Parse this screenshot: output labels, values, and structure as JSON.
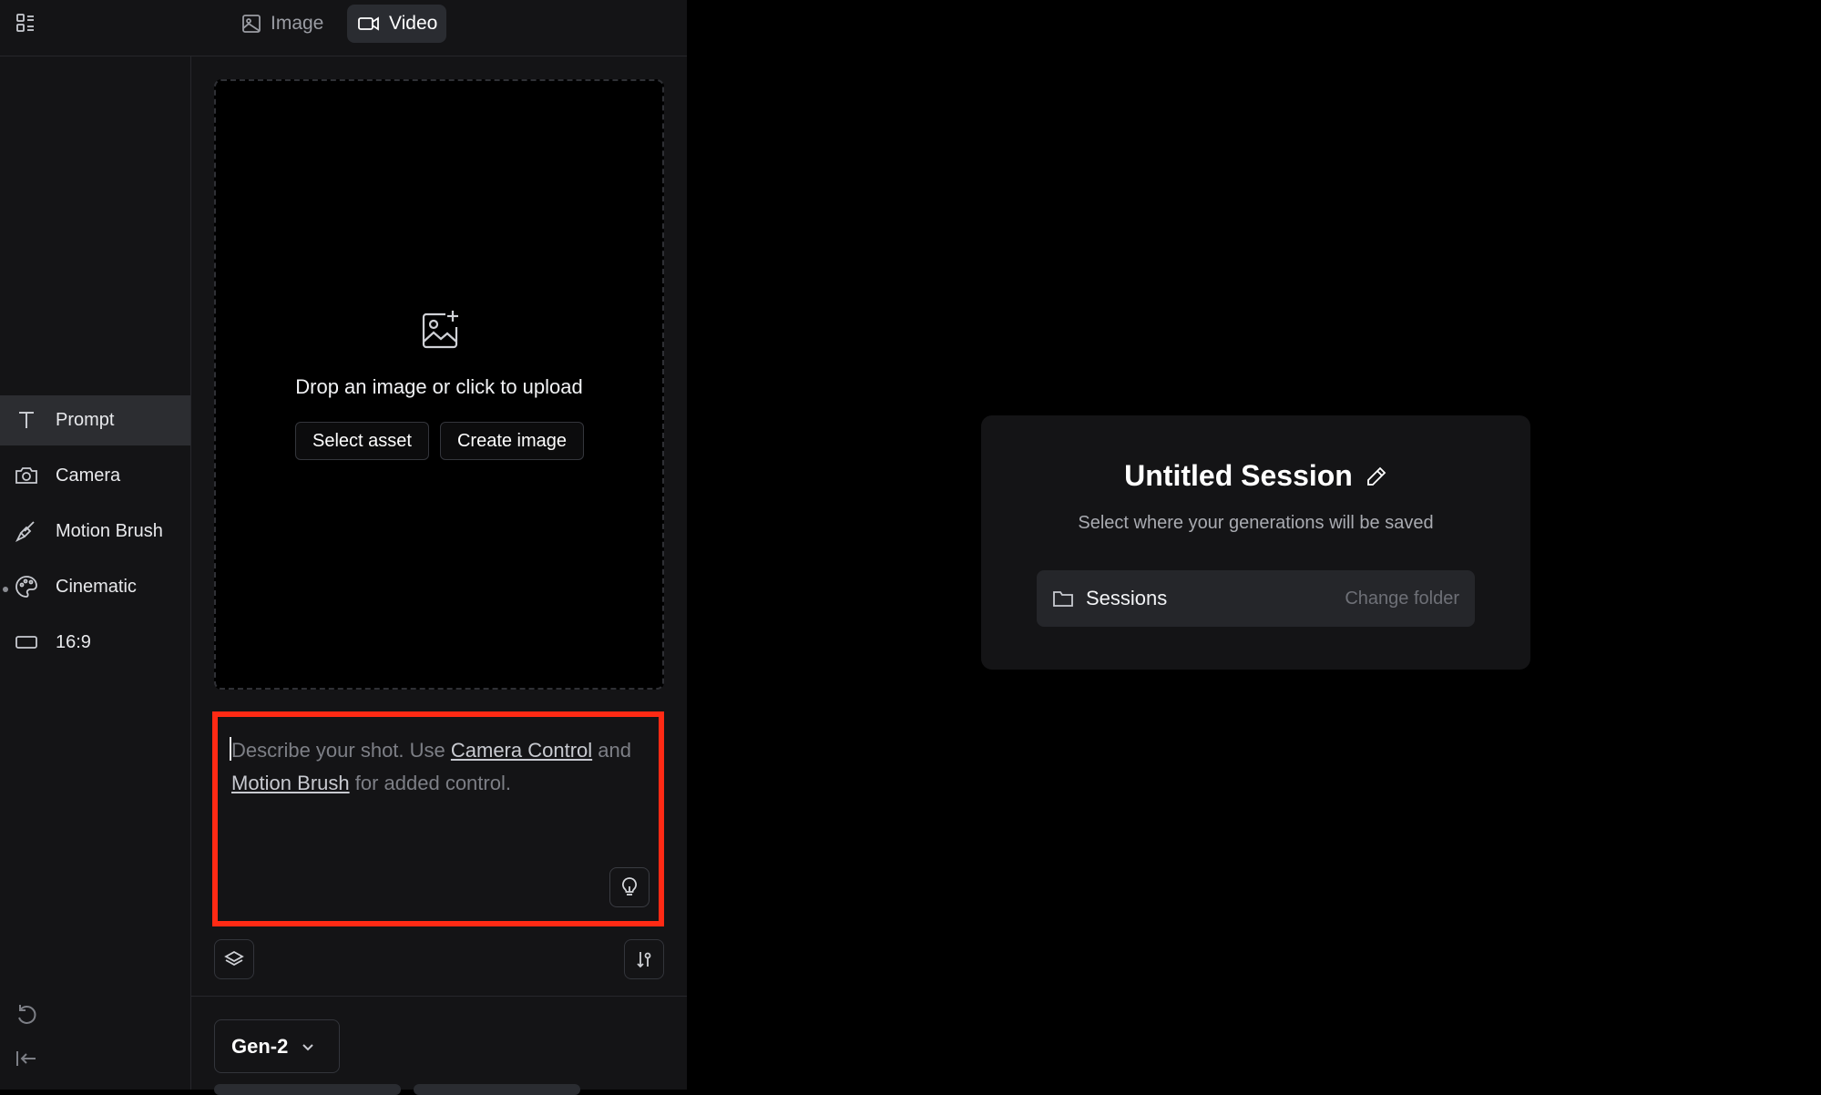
{
  "topbar": {
    "tabs": [
      {
        "label": "Image",
        "icon": "image-icon",
        "active": false
      },
      {
        "label": "Video",
        "icon": "video-camera-icon",
        "active": true
      }
    ]
  },
  "sidebar": {
    "items": [
      {
        "label": "Prompt",
        "icon": "text-t-icon",
        "active": true
      },
      {
        "label": "Camera",
        "icon": "camera-icon"
      },
      {
        "label": "Motion Brush",
        "icon": "brush-icon"
      },
      {
        "label": "Cinematic",
        "icon": "palette-icon",
        "indicator": true
      },
      {
        "label": "16:9",
        "icon": "aspect-ratio-icon"
      }
    ],
    "bottom_icons": [
      "undo-icon",
      "collapse-sidebar-icon"
    ]
  },
  "upload": {
    "text": "Drop an image or click to upload",
    "select_asset": "Select asset",
    "create_image": "Create image"
  },
  "prompt": {
    "placeholder_part1": "Describe your shot. Use ",
    "link1": "Camera Control",
    "placeholder_part2": " and ",
    "link2": "Motion Brush",
    "placeholder_part3": " for added control."
  },
  "model": {
    "selected": "Gen-2"
  },
  "session": {
    "title": "Untitled Session",
    "subtitle": "Select where your generations will be saved",
    "folder": "Sessions",
    "change_folder": "Change folder"
  },
  "colors": {
    "highlight_border": "#ff2a14",
    "panel_bg": "#141416",
    "canvas_bg": "#000000"
  }
}
